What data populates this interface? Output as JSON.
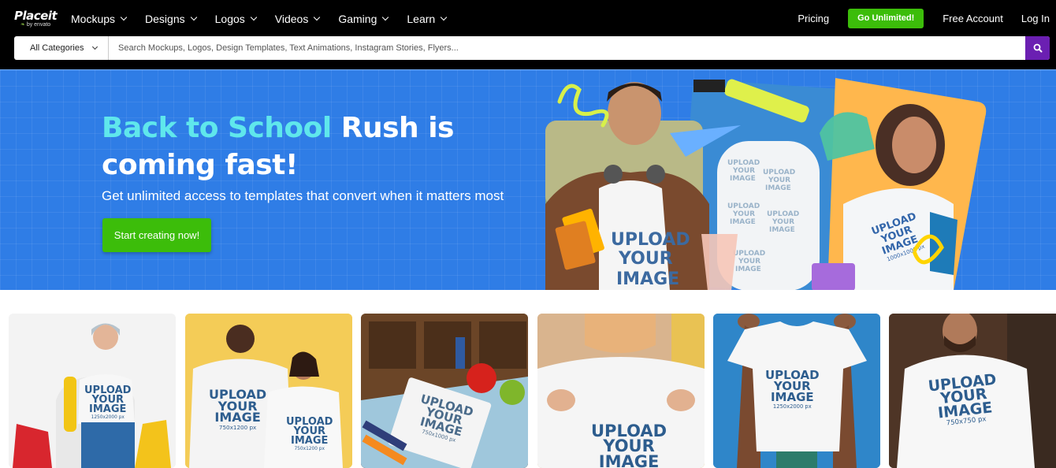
{
  "brand": {
    "name": "Placeit",
    "sub": "by envato"
  },
  "nav": {
    "items": [
      "Mockups",
      "Designs",
      "Logos",
      "Videos",
      "Gaming",
      "Learn"
    ],
    "pricing": "Pricing",
    "go_unlimited": "Go Unlimited!",
    "free_account": "Free Account",
    "login": "Log In"
  },
  "search": {
    "category": "All Categories",
    "placeholder": "Search Mockups, Logos, Design Templates, Text Animations, Instagram Stories, Flyers..."
  },
  "hero": {
    "title_highlight": "Back to School",
    "title_rest": "Rush is coming fast!",
    "subtitle": "Get unlimited access to templates that convert when it matters most",
    "cta": "Start creating now!",
    "art_text": {
      "line1": "UPLOAD",
      "line2": "YOUR",
      "line3": "IMAGE",
      "jacket_size": "1000x1000 px"
    }
  },
  "cards": [
    {
      "line1": "UPLOAD",
      "line2": "YOUR",
      "line3": "IMAGE",
      "size": "1250x2000 px"
    },
    {
      "line1": "UPLOAD",
      "line2": "YOUR",
      "line3": "IMAGE",
      "size": "750x1200 px",
      "size2": "750x1200 px"
    },
    {
      "line1": "UPLOAD",
      "line2": "YOUR",
      "line3": "IMAGE",
      "size": "750x1000 px"
    },
    {
      "line1": "UPLOAD",
      "line2": "YOUR",
      "line3": "IMAGE",
      "size": ""
    },
    {
      "line1": "UPLOAD",
      "line2": "YOUR",
      "line3": "IMAGE",
      "size": "1250x2000 px"
    },
    {
      "line1": "UPLOAD",
      "line2": "YOUR",
      "line3": "IMAGE",
      "size": "750x750 px"
    }
  ],
  "colors": {
    "accent_green": "#3cbd0a",
    "hero_blue": "#2f7de6",
    "highlight_cyan": "#5fe7ec",
    "search_purple": "#6b1fb2"
  }
}
